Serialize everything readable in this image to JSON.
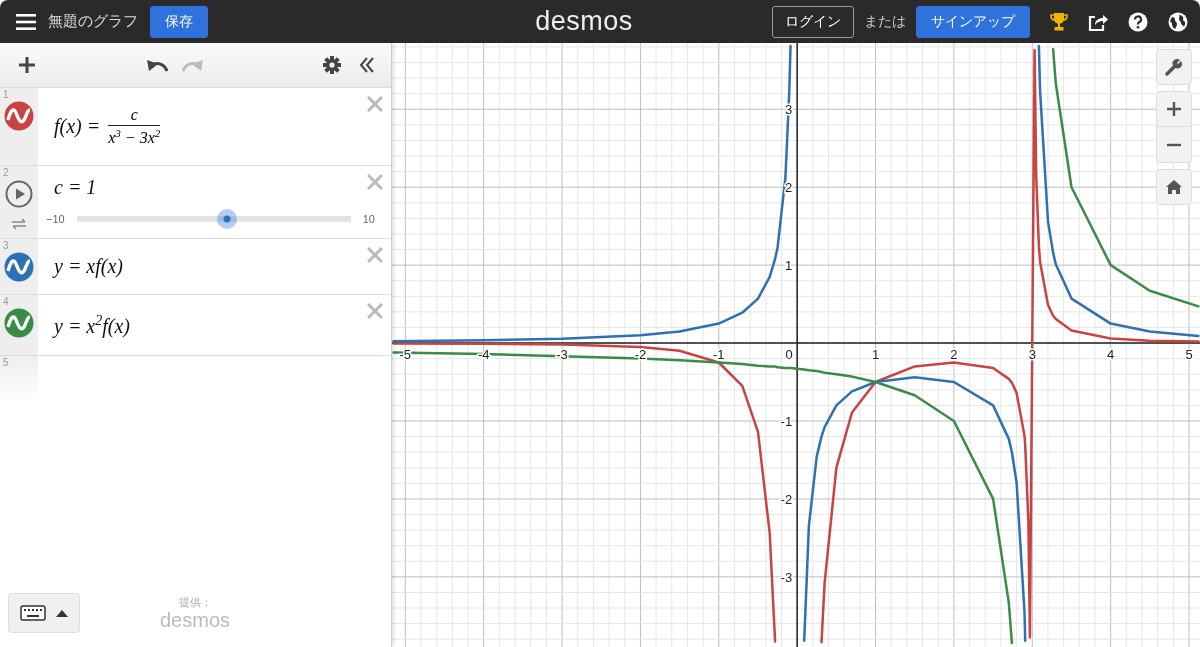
{
  "header": {
    "title": "無題のグラフ",
    "save_button": "保存",
    "logo": "desmos",
    "login_button": "ログイン",
    "or_text": "または",
    "signup_button": "サインアップ"
  },
  "expressions": [
    {
      "number": "1",
      "kind": "fraction",
      "color": "#c74440",
      "lhs": "f(x) =",
      "numerator": "c",
      "denominator": "x$^{3}$ − 3x$^{2}$"
    },
    {
      "number": "2",
      "kind": "slider",
      "text": "c = 1",
      "min": "−10",
      "max": "10",
      "level": 0.55
    },
    {
      "number": "3",
      "kind": "equation",
      "color": "#2d70b3",
      "text": "y = xf(x)"
    },
    {
      "number": "4",
      "kind": "equation",
      "color": "#388c46",
      "text": "y = x$^{2}$f(x)"
    },
    {
      "number": "5",
      "kind": "empty"
    }
  ],
  "footer": {
    "credit": "提供：",
    "logo": "desmos"
  },
  "graph": {
    "chart_data": {
      "type": "line",
      "grid": true,
      "x": [
        -5.15,
        -4,
        -3,
        -2,
        -1.5,
        -1,
        -0.7,
        -0.5,
        -0.35,
        -0.282,
        -0.25,
        -0.15,
        -0.1,
        -0.085,
        0,
        0.09,
        0.15,
        0.25,
        0.311,
        0.35,
        0.5,
        0.7,
        1,
        1.5,
        2,
        2.5,
        2.7,
        2.74,
        2.8,
        2.9,
        2.91,
        2.95,
        2.97,
        3.029,
        3.05,
        3.085,
        3.1,
        3.2,
        3.265,
        3.3,
        3.5,
        4,
        4.5,
        5.12
      ],
      "series": [
        {
          "color": "#c74440",
          "values": [
            -0.005,
            -0.009,
            -0.019,
            -0.05,
            -0.099,
            -0.25,
            -0.55,
            -1.14,
            -2.44,
            -3.83,
            null,
            null,
            null,
            null,
            null,
            null,
            null,
            null,
            -3.84,
            -3.08,
            -1.6,
            -0.89,
            -0.5,
            -0.3,
            -0.25,
            -0.32,
            -0.46,
            -0.51,
            -0.64,
            -1.19,
            -1.31,
            -2.3,
            -3.78,
            3.76,
            2.15,
            1.24,
            1.04,
            0.49,
            0.35,
            0.31,
            0.16,
            0.06,
            0.03,
            0.02
          ]
        },
        {
          "color": "#2d70b3",
          "values": [
            0.024,
            0.036,
            0.056,
            0.1,
            0.15,
            0.25,
            0.39,
            0.57,
            0.85,
            1.08,
            1.23,
            2.12,
            3.23,
            3.81,
            null,
            -3.82,
            -2.34,
            -1.45,
            -1.2,
            -1.08,
            -0.8,
            -0.62,
            -0.5,
            -0.44,
            -0.5,
            -0.8,
            -1.23,
            -1.4,
            -1.79,
            -3.45,
            -3.82,
            null,
            null,
            null,
            null,
            3.81,
            3.23,
            1.56,
            1.16,
            1.01,
            0.57,
            0.25,
            0.15,
            0.09
          ]
        },
        {
          "color": "#388c46",
          "values": [
            -0.12,
            -0.14,
            -0.17,
            -0.2,
            -0.22,
            -0.25,
            -0.27,
            -0.29,
            -0.3,
            -0.3,
            -0.31,
            -0.32,
            -0.32,
            -0.32,
            -0.33,
            -0.34,
            -0.35,
            -0.36,
            -0.37,
            -0.38,
            -0.4,
            -0.43,
            -0.5,
            -0.67,
            -1,
            -2,
            -3.33,
            -3.85,
            null,
            null,
            null,
            null,
            null,
            null,
            null,
            null,
            null,
            null,
            3.77,
            3.33,
            2,
            1,
            0.67,
            0.47
          ]
        }
      ],
      "xlim": [
        -5.17,
        5.14
      ],
      "ylim": [
        -3.9,
        3.85
      ],
      "xticks": [
        -5,
        -4,
        -3,
        -2,
        -1,
        0,
        1,
        2,
        3,
        4,
        5
      ],
      "yticks": [
        -3,
        -2,
        -1,
        1,
        2,
        3
      ]
    }
  }
}
